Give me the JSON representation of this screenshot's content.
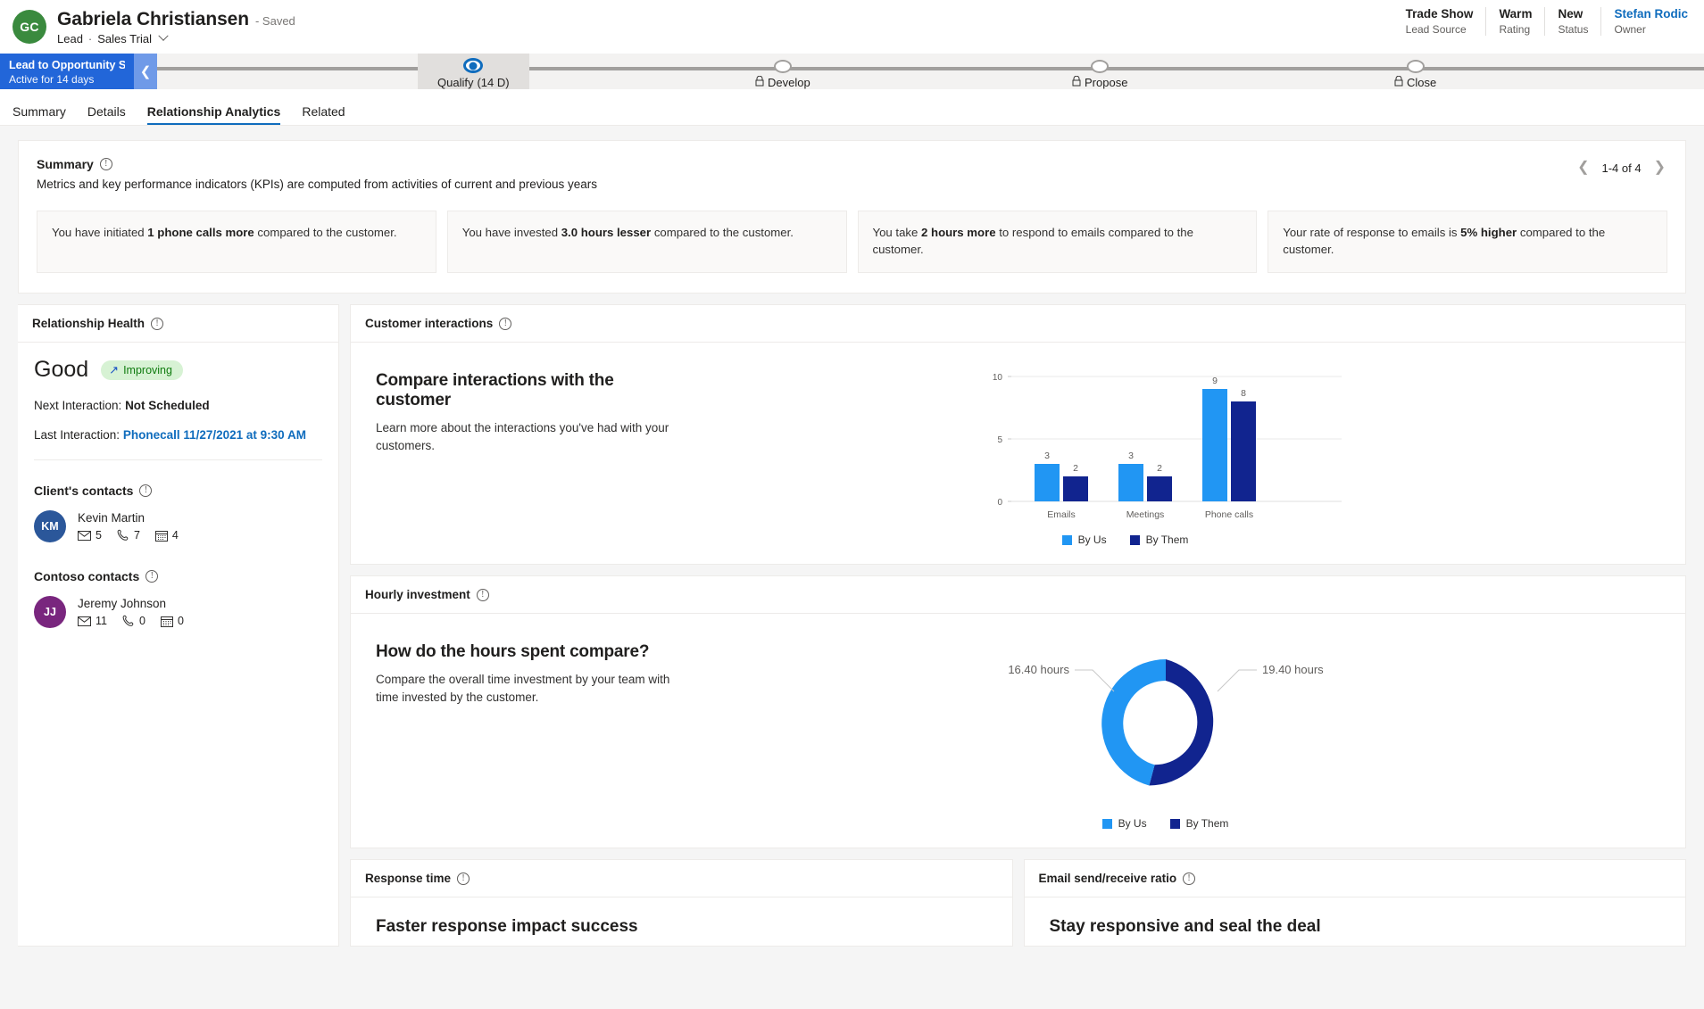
{
  "header": {
    "avatar_initials": "GC",
    "record_name": "Gabriela Christiansen",
    "saved_state": "- Saved",
    "entity_type": "Lead",
    "separator": "·",
    "form_name": "Sales Trial",
    "fields": [
      {
        "value": "Trade Show",
        "label": "Lead Source",
        "is_link": false
      },
      {
        "value": "Warm",
        "label": "Rating",
        "is_link": false
      },
      {
        "value": "New",
        "label": "Status",
        "is_link": false
      },
      {
        "value": "Stefan Rodic",
        "label": "Owner",
        "is_link": true
      }
    ]
  },
  "process_flow": {
    "name": "Lead to Opportunity Sal...",
    "active_for": "Active for 14 days",
    "collapse_icon": "chevron-left-icon",
    "stages": [
      {
        "label": "Qualify",
        "duration": "(14 D)",
        "state": "active",
        "locked": false
      },
      {
        "label": "Develop",
        "duration": "",
        "state": "locked",
        "locked": true
      },
      {
        "label": "Propose",
        "duration": "",
        "state": "locked",
        "locked": true
      },
      {
        "label": "Close",
        "duration": "",
        "state": "locked",
        "locked": true
      }
    ]
  },
  "tabs": [
    {
      "label": "Summary",
      "active": false
    },
    {
      "label": "Details",
      "active": false
    },
    {
      "label": "Relationship Analytics",
      "active": true
    },
    {
      "label": "Related",
      "active": false
    }
  ],
  "summary": {
    "title": "Summary",
    "info_icon": "info-icon",
    "subtitle": "Metrics and key performance indicators (KPIs) are computed from activities of current and previous years",
    "pager": {
      "prev_icon": "chevron-left-icon",
      "range": "1-4 of 4",
      "next_icon": "chevron-right-icon"
    },
    "kpis": [
      {
        "pre": "You have initiated ",
        "bold": "1 phone calls more",
        "post": " compared to the customer."
      },
      {
        "pre": "You have invested ",
        "bold": "3.0 hours lesser",
        "post": " compared to the customer."
      },
      {
        "pre": "You take ",
        "bold": "2 hours more",
        "post": " to respond to emails compared to the customer."
      },
      {
        "pre": "Your rate of response to emails is ",
        "bold": "5% higher",
        "post": " compared to the customer."
      }
    ]
  },
  "relationship_health": {
    "title": "Relationship Health",
    "info_icon": "info-icon",
    "score": "Good",
    "trend_badge": {
      "icon": "trending-up-icon",
      "label": "Improving"
    },
    "next_interaction_label": "Next Interaction:",
    "next_interaction_value": "Not Scheduled",
    "last_interaction_label": "Last Interaction:",
    "last_interaction_value": "Phonecall 11/27/2021 at 9:30 AM"
  },
  "clients_contacts": {
    "title": "Client's contacts",
    "info_icon": "info-icon",
    "contacts": [
      {
        "initials": "KM",
        "name": "Kevin Martin",
        "avatar_color": "#2b579a",
        "email_icon": "envelope-icon",
        "emails": "5",
        "phone_icon": "phone-icon",
        "calls": "7",
        "meeting_icon": "calendar-icon",
        "meetings": "4"
      }
    ]
  },
  "contoso_contacts": {
    "title": "Contoso contacts",
    "info_icon": "info-icon",
    "contacts": [
      {
        "initials": "JJ",
        "name": "Jeremy Johnson",
        "avatar_color": "#79267e",
        "email_icon": "envelope-icon",
        "emails": "11",
        "phone_icon": "phone-icon",
        "calls": "0",
        "meeting_icon": "calendar-icon",
        "meetings": "0"
      }
    ]
  },
  "customer_interactions": {
    "panel_title": "Customer interactions",
    "info_icon": "info-icon",
    "heading": "Compare interactions with the customer",
    "description": "Learn more about the interactions you've had with your customers."
  },
  "hourly_investment": {
    "panel_title": "Hourly investment",
    "info_icon": "info-icon",
    "heading": "How do the hours spent compare?",
    "description": "Compare the overall time investment by your team with time invested by the customer."
  },
  "response_time": {
    "panel_title": "Response time",
    "info_icon": "info-icon",
    "heading": "Faster response impact success"
  },
  "email_ratio": {
    "panel_title": "Email send/receive ratio",
    "info_icon": "info-icon",
    "heading": "Stay responsive and seal the deal"
  },
  "colors": {
    "by_us": "#2196f3",
    "by_them": "#11248f",
    "accent": "#0f6cbd",
    "bpf_header": "#2266d9",
    "health_good": "#107c10"
  },
  "chart_data": [
    {
      "type": "bar",
      "title": "Compare interactions with the customer",
      "categories": [
        "Emails",
        "Meetings",
        "Phone calls"
      ],
      "series": [
        {
          "name": "By Us",
          "values": [
            3,
            3,
            9
          ],
          "color": "#2196f3"
        },
        {
          "name": "By Them",
          "values": [
            2,
            2,
            8
          ],
          "color": "#11248f"
        }
      ],
      "ylim": [
        0,
        10
      ],
      "yticks": [
        "0",
        "5",
        "10"
      ],
      "xlabel": "",
      "ylabel": "",
      "grid": true,
      "legend_position": "bottom",
      "data_labels": true
    },
    {
      "type": "pie",
      "title": "How do the hours spent compare?",
      "labels": [
        "By Us",
        "By Them"
      ],
      "values": [
        16.4,
        19.4
      ],
      "value_labels": [
        "16.40 hours",
        "19.40 hours"
      ],
      "colors": [
        "#2196f3",
        "#11248f"
      ],
      "donut": true,
      "legend_position": "bottom"
    }
  ]
}
